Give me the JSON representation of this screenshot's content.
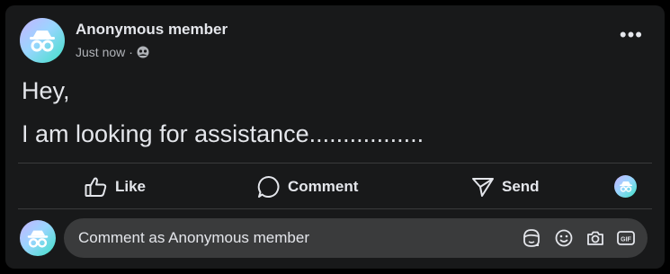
{
  "post": {
    "author": "Anonymous member",
    "timestamp": "Just now",
    "separator": "·",
    "audience_icon": "group-icon",
    "more_icon": "more-options-icon",
    "more_glyph": "•••",
    "text_line1": "Hey,",
    "text_line2": "I am looking for assistance................."
  },
  "actions": {
    "like_label": "Like",
    "comment_label": "Comment",
    "send_label": "Send"
  },
  "comment_box": {
    "placeholder": "Comment as Anonymous member",
    "icons": [
      "avatar-sticker-icon",
      "emoji-icon",
      "camera-icon",
      "gif-icon"
    ]
  },
  "colors": {
    "card_bg": "#18191a",
    "text": "#e4e6eb",
    "muted": "#b0b3b8",
    "input_bg": "#3a3b3c"
  }
}
